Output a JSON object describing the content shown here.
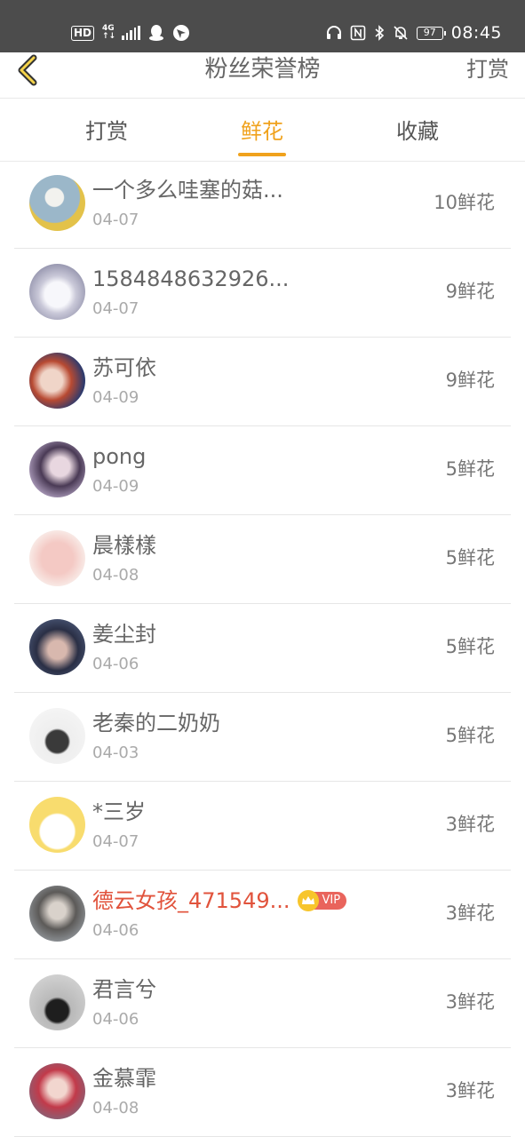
{
  "status_bar": {
    "hd": "HD",
    "network_top": "4G",
    "network_bottom": "↑↓",
    "battery": "97",
    "time": "08:45"
  },
  "header": {
    "title": "粉丝荣誉榜",
    "action": "打赏",
    "back_icon": "chevron-left-icon",
    "accent_color": "#f0a21c"
  },
  "tabs": [
    {
      "label": "打赏",
      "active": false
    },
    {
      "label": "鲜花",
      "active": true
    },
    {
      "label": "收藏",
      "active": false
    }
  ],
  "fans": [
    {
      "name": "一个多么哇塞的菇...",
      "date": "04-07",
      "amount": "10鲜花",
      "vip": false
    },
    {
      "name": "1584848632926...",
      "date": "04-07",
      "amount": "9鲜花",
      "vip": false
    },
    {
      "name": "苏可依",
      "date": "04-09",
      "amount": "9鲜花",
      "vip": false
    },
    {
      "name": "pong",
      "date": "04-09",
      "amount": "5鲜花",
      "vip": false
    },
    {
      "name": "晨樣樣",
      "date": "04-08",
      "amount": "5鲜花",
      "vip": false
    },
    {
      "name": "姜尘封",
      "date": "04-06",
      "amount": "5鲜花",
      "vip": false
    },
    {
      "name": "老秦的二奶奶",
      "date": "04-03",
      "amount": "5鲜花",
      "vip": false
    },
    {
      "name": "*三岁",
      "date": "04-07",
      "amount": "3鲜花",
      "vip": false
    },
    {
      "name": "德云女孩_471549...",
      "date": "04-06",
      "amount": "3鲜花",
      "vip": true,
      "vip_label": "VIP"
    },
    {
      "name": "君言兮",
      "date": "04-06",
      "amount": "3鲜花",
      "vip": false
    },
    {
      "name": "金慕霏",
      "date": "04-08",
      "amount": "3鲜花",
      "vip": false
    }
  ]
}
